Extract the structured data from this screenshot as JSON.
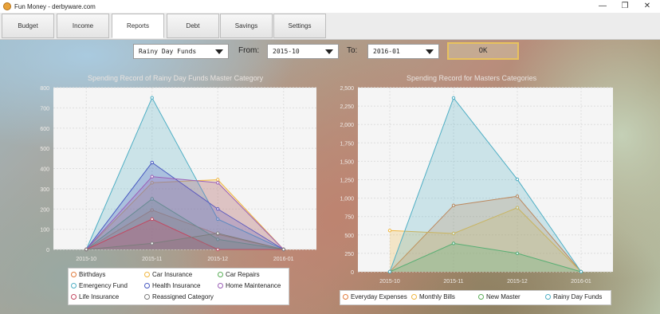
{
  "app": {
    "title": "Fun Money - derbyware.com"
  },
  "window_controls": {
    "minimize": "—",
    "restore": "❐",
    "close": "✕"
  },
  "tabs": [
    {
      "label": "Budget"
    },
    {
      "label": "Income"
    },
    {
      "label": "Reports",
      "active": true
    },
    {
      "label": "Debt"
    },
    {
      "label": "Savings"
    },
    {
      "label": "Settings"
    }
  ],
  "filters": {
    "category": "Rainy Day Funds",
    "from_label": "From:",
    "from_value": "2015-10",
    "to_label": "To:",
    "to_value": "2016-01",
    "ok_label": "OK"
  },
  "colors": {
    "accent_ok_border": "#e8c25e"
  },
  "chart_data": [
    {
      "type": "area",
      "title": "Spending Record of Rainy Day Funds Master Category",
      "xlabel": "",
      "ylabel": "",
      "categories": [
        "2015-10",
        "2015-11",
        "2015-12",
        "2016-01"
      ],
      "ylim": [
        0,
        800
      ],
      "yticks": [
        0,
        100,
        200,
        300,
        400,
        500,
        600,
        700,
        800
      ],
      "grid": true,
      "legend": "bottom",
      "series": [
        {
          "name": "Birthdays",
          "color": "#e07b3c",
          "values": [
            0,
            195,
            75,
            0
          ]
        },
        {
          "name": "Car Insurance",
          "color": "#f0b63f",
          "values": [
            0,
            330,
            345,
            0
          ]
        },
        {
          "name": "Car Repairs",
          "color": "#5bae59",
          "values": [
            0,
            250,
            50,
            0
          ]
        },
        {
          "name": "Emergency Fund",
          "color": "#4eaec4",
          "values": [
            0,
            750,
            150,
            0
          ]
        },
        {
          "name": "Health Insurance",
          "color": "#4758c0",
          "values": [
            0,
            430,
            200,
            0
          ]
        },
        {
          "name": "Home Maintenance",
          "color": "#9b5fb6",
          "values": [
            0,
            360,
            330,
            0
          ]
        },
        {
          "name": "Life Insurance",
          "color": "#c24861",
          "values": [
            0,
            150,
            0,
            0
          ]
        },
        {
          "name": "Reassigned Category",
          "color": "#7d7d7d",
          "values": [
            0,
            30,
            80,
            0
          ]
        }
      ]
    },
    {
      "type": "area",
      "title": "Spending Record for Masters Categories",
      "xlabel": "",
      "ylabel": "",
      "categories": [
        "2015-10",
        "2015-11",
        "2015-12",
        "2016-01"
      ],
      "ylim": [
        0,
        2500
      ],
      "yticks": [
        0,
        250,
        500,
        750,
        1000,
        1250,
        1500,
        1750,
        2000,
        2250,
        2500
      ],
      "ytick_labels": [
        "0",
        "250",
        "500",
        "750",
        "1,000",
        "1,250",
        "1,500",
        "1,750",
        "2,000",
        "2,250",
        "2,500"
      ],
      "grid": true,
      "legend": "bottom",
      "series": [
        {
          "name": "Everyday Expenses",
          "color": "#e07b3c",
          "values": [
            0,
            900,
            1025,
            0
          ]
        },
        {
          "name": "Monthly Bills",
          "color": "#f0b63f",
          "values": [
            560,
            520,
            870,
            0
          ]
        },
        {
          "name": "New Master",
          "color": "#5bae59",
          "values": [
            0,
            385,
            250,
            0
          ]
        },
        {
          "name": "Rainy Day Funds",
          "color": "#4eaec4",
          "values": [
            0,
            2360,
            1255,
            0
          ]
        }
      ]
    }
  ]
}
